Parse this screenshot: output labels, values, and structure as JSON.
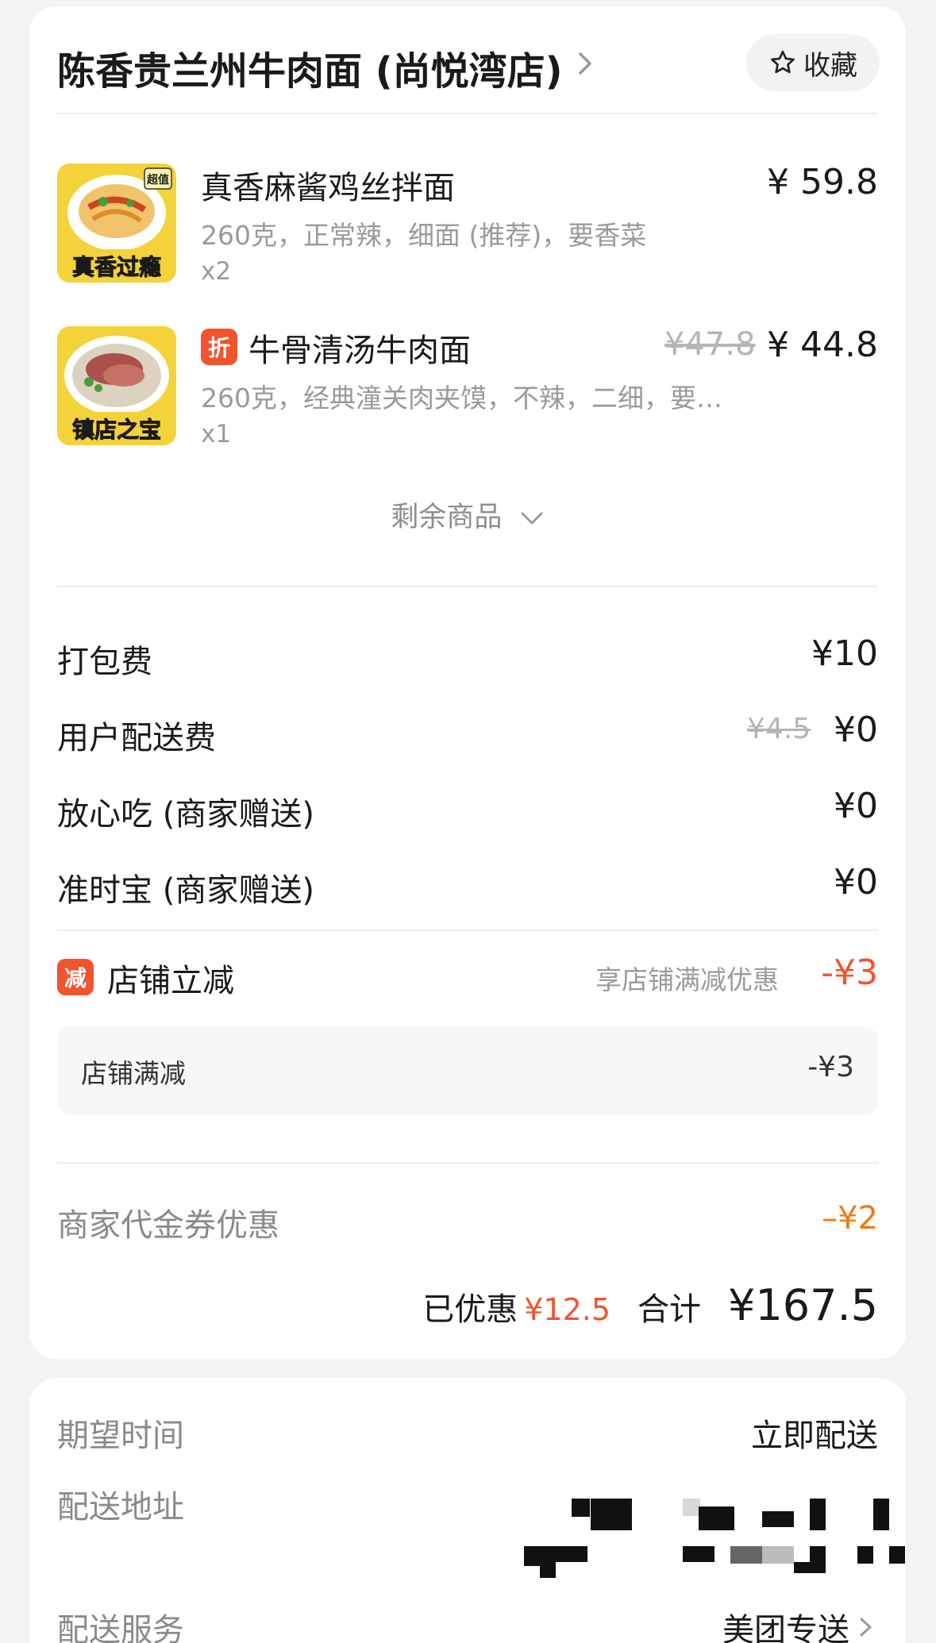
{
  "shop": {
    "name": "陈香贵兰州牛肉面 (尚悦湾店)",
    "favorite_label": "收藏"
  },
  "items": [
    {
      "name": "真香麻酱鸡丝拌面",
      "spec": "260克，正常辣，细面 (推荐)，要香菜",
      "qty": "x2",
      "price": "¥ 59.8",
      "thumb_label": "真香过瘾",
      "thumb_badge": "超值"
    },
    {
      "name": "牛骨清汤牛肉面",
      "spec": "260克，经典潼关肉夹馍，不辣，二细，要…",
      "qty": "x1",
      "orig_price": "¥47.8",
      "price": "¥ 44.8",
      "tag": "折",
      "thumb_label": "镇店之宝"
    }
  ],
  "more_items_label": "剩余商品",
  "fees": [
    {
      "label": "打包费",
      "value": "¥10"
    },
    {
      "label": "用户配送费",
      "orig": "¥4.5",
      "value": "¥0"
    },
    {
      "label": "放心吃 (商家赠送)",
      "value": "¥0"
    },
    {
      "label": "准时宝 (商家赠送)",
      "value": "¥0"
    }
  ],
  "discount": {
    "tag": "减",
    "label": "店铺立减",
    "hint": "享店铺满减优惠",
    "value": "-¥3",
    "detail_label": "店铺满减",
    "detail_value": "-¥3"
  },
  "voucher": {
    "label": "商家代金券优惠",
    "value": "–¥2"
  },
  "summary": {
    "saved_label": "已优惠",
    "saved_value": "¥12.5",
    "total_label": "合计",
    "total_value": "¥167.5"
  },
  "delivery": {
    "time_label": "期望时间",
    "time_value": "立即配送",
    "address_label": "配送地址",
    "service_label": "配送服务",
    "service_value": "美团专送"
  },
  "colors": {
    "accent_red": "#f2542d",
    "accent_orange": "#f07a12",
    "muted_text": "#9a9a9a"
  }
}
